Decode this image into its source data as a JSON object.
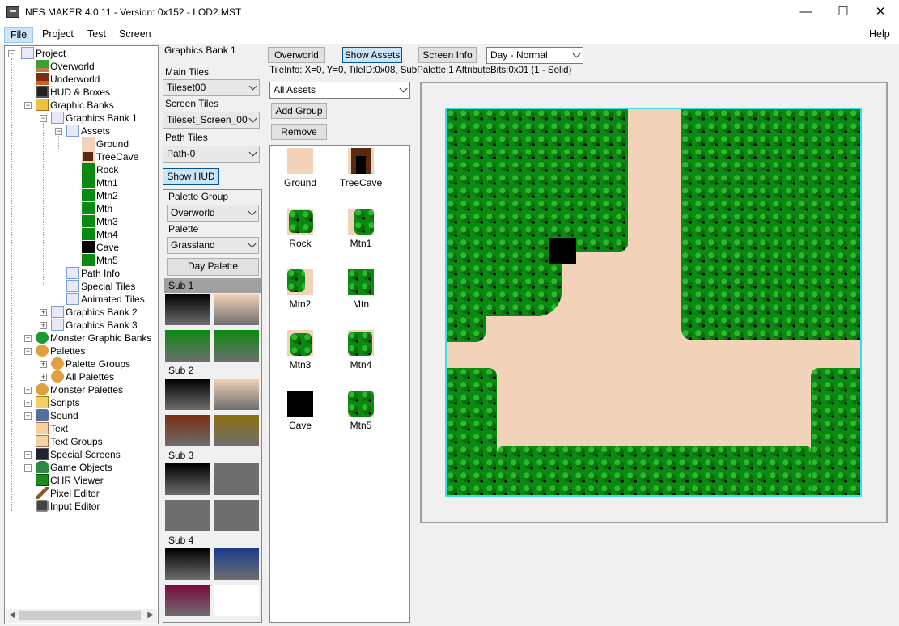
{
  "window": {
    "title": "NES MAKER 4.0.11 - Version: 0x152 - LOD2.MST",
    "minimize": "—",
    "maximize": "☐",
    "close": "✕"
  },
  "menu": {
    "file": "File",
    "project": "Project",
    "test": "Test",
    "screen": "Screen",
    "help": "Help"
  },
  "tree": {
    "project": "Project",
    "overworld": "Overworld",
    "underworld": "Underworld",
    "hud": "HUD & Boxes",
    "graphic_banks": "Graphic Banks",
    "graphics_bank_1": "Graphics Bank 1",
    "assets": "Assets",
    "ground": "Ground",
    "treecave": "TreeCave",
    "rock": "Rock",
    "mtn1": "Mtn1",
    "mtn2": "Mtn2",
    "mtn": "Mtn",
    "mtn3": "Mtn3",
    "mtn4": "Mtn4",
    "cave": "Cave",
    "mtn5": "Mtn5",
    "path_info": "Path Info",
    "special_tiles": "Special Tiles",
    "animated_tiles": "Animated Tiles",
    "graphics_bank_2": "Graphics Bank 2",
    "graphics_bank_3": "Graphics Bank 3",
    "monster_graphic_banks": "Monster Graphic Banks",
    "palettes": "Palettes",
    "palette_groups": "Palette Groups",
    "all_palettes": "All Palettes",
    "monster_palettes": "Monster Palettes",
    "scripts": "Scripts",
    "sound": "Sound",
    "text": "Text",
    "text_groups": "Text Groups",
    "special_screens": "Special Screens",
    "game_objects": "Game Objects",
    "chr_viewer": "CHR Viewer",
    "pixel_editor": "Pixel Editor",
    "input_editor": "Input Editor"
  },
  "settings": {
    "bank_title": "Graphics Bank 1",
    "main_tiles_label": "Main Tiles",
    "main_tiles_value": "Tileset00",
    "screen_tiles_label": "Screen Tiles",
    "screen_tiles_value": "Tileset_Screen_00",
    "path_tiles_label": "Path Tiles",
    "path_tiles_value": "Path-0",
    "show_hud": "Show HUD",
    "palette_group_label": "Palette Group",
    "palette_group_value": "Overworld",
    "palette_label": "Palette",
    "palette_value": "Grassland",
    "day_palette": "Day Palette"
  },
  "subpalettes": [
    {
      "label": "Sub 1",
      "colors": [
        "#000000",
        "#f2d3b9",
        "#0a8a10",
        "#0a8a10"
      ]
    },
    {
      "label": "Sub 2",
      "colors": [
        "#000000",
        "#f2d3b9",
        "#7a2e10",
        "#8a7010"
      ]
    },
    {
      "label": "Sub 3",
      "colors": [
        "#000000",
        "#6e6e6e",
        "#6e6e6e",
        "#6e6e6e"
      ]
    },
    {
      "label": "Sub 4",
      "colors": [
        "#000000",
        "#1a3c8c",
        "#7a0a3a",
        "#ffffff"
      ]
    }
  ],
  "toolbar": {
    "overworld": "Overworld",
    "show_assets": "Show Assets",
    "screen_info": "Screen Info",
    "time_of_day": "Day - Normal",
    "tileinfo": "TileInfo: X=0, Y=0, TileID:0x08, SubPalette:1 AttributeBits:0x01 (1 - Solid)"
  },
  "assets": {
    "filter": "All Assets",
    "add_group": "Add Group",
    "remove": "Remove",
    "items": [
      "Ground",
      "TreeCave",
      "Rock",
      "Mtn1",
      "Mtn2",
      "Mtn",
      "Mtn3",
      "Mtn4",
      "Cave",
      "Mtn5"
    ]
  },
  "colors": {
    "ground": "#f2d3b9",
    "tree_green": "#0a8a10",
    "screen_border": "#37e0e6",
    "selection": "#cce4f7"
  }
}
